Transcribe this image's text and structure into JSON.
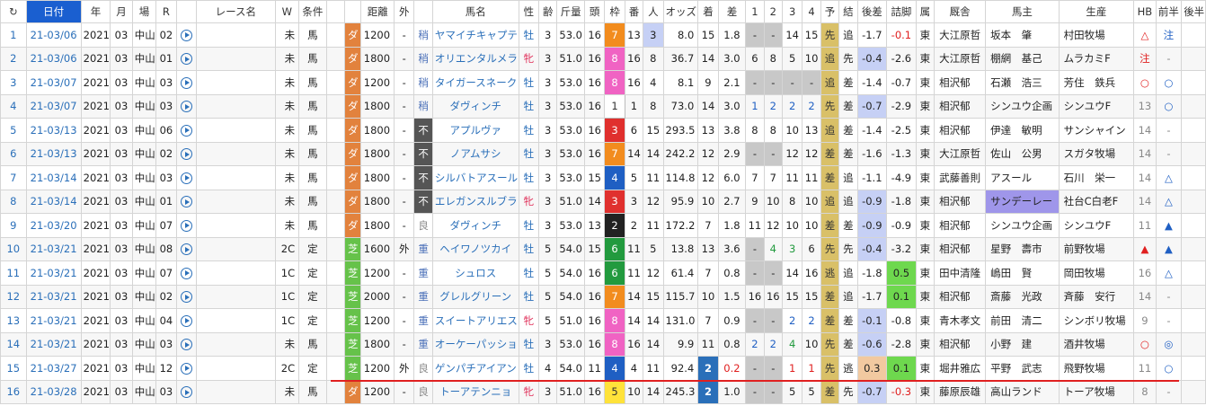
{
  "header": [
    "↻",
    "日付",
    "年",
    "月",
    "場",
    "R",
    "",
    "レース名",
    "W",
    "条件",
    "",
    "",
    "距離",
    "外",
    "",
    "馬名",
    "性",
    "齢",
    "斤量",
    "頭",
    "枠",
    "番",
    "人",
    "オッズ",
    "着",
    "差",
    "1",
    "2",
    "3",
    "4",
    "予",
    "結",
    "後差",
    "詰脚",
    "属",
    "厩舎",
    "馬主",
    "生産",
    "HB",
    "前半",
    "後半"
  ],
  "rows": [
    {
      "n": "1",
      "date": "21-03/06",
      "y": "2021",
      "m": "03",
      "jo": "中山",
      "r": "02",
      "w": "",
      "jk": "未",
      "ba": "馬",
      "surf": "ダ",
      "dist": "1200",
      "gai": "-",
      "mark": "稍",
      "horse": "ヤマイチキャプテン",
      "sex": "牡",
      "age": "3",
      "kin": "53.0",
      "tou": "16",
      "waku": "7",
      "ban": "13",
      "nin": "3",
      "odds": "8.0",
      "chaku": "15",
      "sa": "1.8",
      "p1": "-",
      "p2": "-",
      "p3": "14",
      "p4": "15",
      "yo": "先",
      "ke": "追",
      "kouh": "-1.7",
      "tsume": "-0.1",
      "zoku": "東",
      "kyu": "大江原哲",
      "owner": "坂本　肇",
      "breed": "村田牧場",
      "hb": "△",
      "zen": "注",
      "kou": ""
    },
    {
      "n": "2",
      "date": "21-03/06",
      "y": "2021",
      "m": "03",
      "jo": "中山",
      "r": "01",
      "w": "",
      "jk": "未",
      "ba": "馬",
      "surf": "ダ",
      "dist": "1800",
      "gai": "-",
      "mark": "稍",
      "horse": "オリエンタルメラク",
      "sex": "牝",
      "age": "3",
      "kin": "51.0",
      "tou": "16",
      "waku": "8",
      "ban": "16",
      "nin": "8",
      "odds": "36.7",
      "chaku": "14",
      "sa": "3.0",
      "p1": "6",
      "p2": "8",
      "p3": "5",
      "p4": "10",
      "yo": "追",
      "ke": "先",
      "kouh": "-0.4",
      "tsume": "-2.6",
      "zoku": "東",
      "kyu": "大江原哲",
      "owner": "棚網　基己",
      "breed": "ムラカミF",
      "hb": "注",
      "zen": "-",
      "kou": ""
    },
    {
      "n": "3",
      "date": "21-03/07",
      "y": "2021",
      "m": "03",
      "jo": "中山",
      "r": "03",
      "w": "",
      "jk": "未",
      "ba": "馬",
      "surf": "ダ",
      "dist": "1200",
      "gai": "-",
      "mark": "稍",
      "horse": "タイガースネーク",
      "sex": "牡",
      "age": "3",
      "kin": "53.0",
      "tou": "16",
      "waku": "8",
      "ban": "16",
      "nin": "4",
      "odds": "8.1",
      "chaku": "9",
      "sa": "2.1",
      "p1": "-",
      "p2": "-",
      "p3": "-",
      "p4": "-",
      "yo": "追",
      "ke": "差",
      "kouh": "-1.4",
      "tsume": "-0.7",
      "zoku": "東",
      "kyu": "相沢郁",
      "owner": "石瀬　浩三",
      "breed": "芳住　鉄兵",
      "hb": "○",
      "zen": "○",
      "kou": ""
    },
    {
      "n": "4",
      "date": "21-03/07",
      "y": "2021",
      "m": "03",
      "jo": "中山",
      "r": "03",
      "w": "",
      "jk": "未",
      "ba": "馬",
      "surf": "ダ",
      "dist": "1800",
      "gai": "-",
      "mark": "稍",
      "horse": "ダヴィンチ",
      "sex": "牡",
      "age": "3",
      "kin": "53.0",
      "tou": "16",
      "waku": "1",
      "ban": "1",
      "nin": "8",
      "odds": "73.0",
      "chaku": "14",
      "sa": "3.0",
      "p1": "1",
      "p2": "2",
      "p3": "2",
      "p4": "2",
      "yo": "先",
      "ke": "差",
      "kouh": "-0.7",
      "tsume": "-2.9",
      "zoku": "東",
      "kyu": "相沢郁",
      "owner": "シンユウ企画",
      "breed": "シンユウF",
      "hb": "13",
      "zen": "○",
      "kou": ""
    },
    {
      "n": "5",
      "date": "21-03/13",
      "y": "2021",
      "m": "03",
      "jo": "中山",
      "r": "06",
      "w": "",
      "jk": "未",
      "ba": "馬",
      "surf": "ダ",
      "dist": "1800",
      "gai": "-",
      "mark": "不",
      "horse": "アプルヴァ",
      "sex": "牡",
      "age": "3",
      "kin": "53.0",
      "tou": "16",
      "waku": "3",
      "ban": "6",
      "nin": "15",
      "odds": "293.5",
      "chaku": "13",
      "sa": "3.8",
      "p1": "8",
      "p2": "8",
      "p3": "10",
      "p4": "13",
      "yo": "追",
      "ke": "差",
      "kouh": "-1.4",
      "tsume": "-2.5",
      "zoku": "東",
      "kyu": "相沢郁",
      "owner": "伊達　敏明",
      "breed": "サンシャイン",
      "hb": "14",
      "zen": "-",
      "kou": ""
    },
    {
      "n": "6",
      "date": "21-03/13",
      "y": "2021",
      "m": "03",
      "jo": "中山",
      "r": "02",
      "w": "",
      "jk": "未",
      "ba": "馬",
      "surf": "ダ",
      "dist": "1800",
      "gai": "-",
      "mark": "不",
      "horse": "ノアムサシ",
      "sex": "牡",
      "age": "3",
      "kin": "53.0",
      "tou": "16",
      "waku": "7",
      "ban": "14",
      "nin": "14",
      "odds": "242.2",
      "chaku": "12",
      "sa": "2.9",
      "p1": "-",
      "p2": "-",
      "p3": "12",
      "p4": "12",
      "yo": "差",
      "ke": "差",
      "kouh": "-1.6",
      "tsume": "-1.3",
      "zoku": "東",
      "kyu": "大江原哲",
      "owner": "佐山　公男",
      "breed": "スガタ牧場",
      "hb": "14",
      "zen": "-",
      "kou": ""
    },
    {
      "n": "7",
      "date": "21-03/14",
      "y": "2021",
      "m": "03",
      "jo": "中山",
      "r": "03",
      "w": "",
      "jk": "未",
      "ba": "馬",
      "surf": "ダ",
      "dist": "1800",
      "gai": "-",
      "mark": "不",
      "horse": "シルバトアスール",
      "sex": "牡",
      "age": "3",
      "kin": "53.0",
      "tou": "15",
      "waku": "4",
      "ban": "5",
      "nin": "11",
      "odds": "114.8",
      "chaku": "12",
      "sa": "6.0",
      "p1": "7",
      "p2": "7",
      "p3": "11",
      "p4": "11",
      "yo": "差",
      "ke": "追",
      "kouh": "-1.1",
      "tsume": "-4.9",
      "zoku": "東",
      "kyu": "武藤善則",
      "owner": "アスール",
      "breed": "石川　栄一",
      "hb": "14",
      "zen": "△",
      "kou": ""
    },
    {
      "n": "8",
      "date": "21-03/14",
      "y": "2021",
      "m": "03",
      "jo": "中山",
      "r": "01",
      "w": "",
      "jk": "未",
      "ba": "馬",
      "surf": "ダ",
      "dist": "1800",
      "gai": "-",
      "mark": "不",
      "horse": "エレガンスルブラ",
      "sex": "牝",
      "age": "3",
      "kin": "51.0",
      "tou": "14",
      "waku": "3",
      "ban": "3",
      "nin": "12",
      "odds": "95.9",
      "chaku": "10",
      "sa": "2.7",
      "p1": "9",
      "p2": "10",
      "p3": "8",
      "p4": "10",
      "yo": "追",
      "ke": "追",
      "kouh": "-0.9",
      "tsume": "-1.8",
      "zoku": "東",
      "kyu": "相沢郁",
      "owner": "サンデーレー",
      "breed": "社台C白老F",
      "hb": "14",
      "zen": "△",
      "kou": ""
    },
    {
      "n": "9",
      "date": "21-03/20",
      "y": "2021",
      "m": "03",
      "jo": "中山",
      "r": "07",
      "w": "",
      "jk": "未",
      "ba": "馬",
      "surf": "ダ",
      "dist": "1800",
      "gai": "-",
      "mark": "良",
      "horse": "ダヴィンチ",
      "sex": "牡",
      "age": "3",
      "kin": "53.0",
      "tou": "13",
      "waku": "2",
      "ban": "2",
      "nin": "11",
      "odds": "172.2",
      "chaku": "7",
      "sa": "1.8",
      "p1": "11",
      "p2": "12",
      "p3": "10",
      "p4": "10",
      "yo": "差",
      "ke": "差",
      "kouh": "-0.9",
      "tsume": "-0.9",
      "zoku": "東",
      "kyu": "相沢郁",
      "owner": "シンユウ企画",
      "breed": "シンユウF",
      "hb": "11",
      "zen": "▲",
      "kou": ""
    },
    {
      "n": "10",
      "date": "21-03/21",
      "y": "2021",
      "m": "03",
      "jo": "中山",
      "r": "08",
      "w": "",
      "jk": "2C",
      "ba": "定",
      "surf": "芝",
      "dist": "1600",
      "gai": "外",
      "mark": "重",
      "horse": "ヘイワノツカイ",
      "sex": "牡",
      "age": "5",
      "kin": "54.0",
      "tou": "15",
      "waku": "6",
      "ban": "11",
      "nin": "5",
      "odds": "13.8",
      "chaku": "13",
      "sa": "3.6",
      "p1": "-",
      "p2": "4",
      "p3": "3",
      "p4": "6",
      "yo": "先",
      "ke": "先",
      "kouh": "-0.4",
      "tsume": "-3.2",
      "zoku": "東",
      "kyu": "相沢郁",
      "owner": "星野　壽市",
      "breed": "前野牧場",
      "hb": "▲",
      "zen": "▲",
      "kou": ""
    },
    {
      "n": "11",
      "date": "21-03/21",
      "y": "2021",
      "m": "03",
      "jo": "中山",
      "r": "07",
      "w": "",
      "jk": "1C",
      "ba": "定",
      "surf": "芝",
      "dist": "1200",
      "gai": "-",
      "mark": "重",
      "horse": "シュロス",
      "sex": "牡",
      "age": "5",
      "kin": "54.0",
      "tou": "16",
      "waku": "6",
      "ban": "11",
      "nin": "12",
      "odds": "61.4",
      "chaku": "7",
      "sa": "0.8",
      "p1": "-",
      "p2": "-",
      "p3": "14",
      "p4": "16",
      "yo": "逃",
      "ke": "追",
      "kouh": "-1.8",
      "tsume": "0.5",
      "zoku": "東",
      "kyu": "田中清隆",
      "owner": "嶋田　賢",
      "breed": "岡田牧場",
      "hb": "16",
      "zen": "△",
      "kou": ""
    },
    {
      "n": "12",
      "date": "21-03/21",
      "y": "2021",
      "m": "03",
      "jo": "中山",
      "r": "02",
      "w": "",
      "jk": "1C",
      "ba": "定",
      "surf": "芝",
      "dist": "2000",
      "gai": "-",
      "mark": "重",
      "horse": "グレルグリーン",
      "sex": "牡",
      "age": "5",
      "kin": "54.0",
      "tou": "16",
      "waku": "7",
      "ban": "14",
      "nin": "15",
      "odds": "115.7",
      "chaku": "10",
      "sa": "1.5",
      "p1": "16",
      "p2": "16",
      "p3": "15",
      "p4": "15",
      "yo": "差",
      "ke": "追",
      "kouh": "-1.7",
      "tsume": "0.1",
      "zoku": "東",
      "kyu": "相沢郁",
      "owner": "斎藤　光政",
      "breed": "斉藤　安行",
      "hb": "14",
      "zen": "-",
      "kou": ""
    },
    {
      "n": "13",
      "date": "21-03/21",
      "y": "2021",
      "m": "03",
      "jo": "中山",
      "r": "04",
      "w": "",
      "jk": "1C",
      "ba": "定",
      "surf": "芝",
      "dist": "1200",
      "gai": "-",
      "mark": "重",
      "horse": "スイートアリエス",
      "sex": "牝",
      "age": "5",
      "kin": "51.0",
      "tou": "16",
      "waku": "8",
      "ban": "14",
      "nin": "14",
      "odds": "131.0",
      "chaku": "7",
      "sa": "0.9",
      "p1": "-",
      "p2": "-",
      "p3": "2",
      "p4": "2",
      "yo": "差",
      "ke": "差",
      "kouh": "-0.1",
      "tsume": "-0.8",
      "zoku": "東",
      "kyu": "青木孝文",
      "owner": "前田　清二",
      "breed": "シンボリ牧場",
      "hb": "9",
      "zen": "-",
      "kou": ""
    },
    {
      "n": "14",
      "date": "21-03/21",
      "y": "2021",
      "m": "03",
      "jo": "中山",
      "r": "03",
      "w": "",
      "jk": "未",
      "ba": "馬",
      "surf": "芝",
      "dist": "1800",
      "gai": "-",
      "mark": "重",
      "horse": "オーケーパッション",
      "sex": "牡",
      "age": "3",
      "kin": "53.0",
      "tou": "16",
      "waku": "8",
      "ban": "16",
      "nin": "14",
      "odds": "9.9",
      "chaku": "11",
      "sa": "0.8",
      "p1": "2",
      "p2": "2",
      "p3": "4",
      "p4": "10",
      "yo": "先",
      "ke": "差",
      "kouh": "-0.6",
      "tsume": "-2.8",
      "zoku": "東",
      "kyu": "相沢郁",
      "owner": "小野　建",
      "breed": "酒井牧場",
      "hb": "○",
      "zen": "◎",
      "kou": ""
    },
    {
      "n": "15",
      "date": "21-03/27",
      "y": "2021",
      "m": "03",
      "jo": "中山",
      "r": "12",
      "w": "",
      "jk": "2C",
      "ba": "定",
      "surf": "芝",
      "dist": "1200",
      "gai": "外",
      "mark": "良",
      "horse": "ゲンパチアイアン",
      "sex": "牡",
      "age": "4",
      "kin": "54.0",
      "tou": "11",
      "waku": "4",
      "ban": "4",
      "nin": "11",
      "odds": "92.4",
      "chaku": "2",
      "sa": "0.2",
      "p1": "-",
      "p2": "-",
      "p3": "1",
      "p4": "1",
      "yo": "先",
      "ke": "逃",
      "kouh": "0.3",
      "tsume": "0.1",
      "zoku": "東",
      "kyu": "堀井雅広",
      "owner": "平野　武志",
      "breed": "飛野牧場",
      "hb": "11",
      "zen": "○",
      "kou": ""
    },
    {
      "n": "16",
      "date": "21-03/28",
      "y": "2021",
      "m": "03",
      "jo": "中山",
      "r": "03",
      "w": "",
      "jk": "未",
      "ba": "馬",
      "surf": "ダ",
      "dist": "1200",
      "gai": "-",
      "mark": "良",
      "horse": "トーアテンニョ",
      "sex": "牝",
      "age": "3",
      "kin": "51.0",
      "tou": "16",
      "waku": "5",
      "ban": "10",
      "nin": "14",
      "odds": "245.3",
      "chaku": "2",
      "sa": "1.0",
      "p1": "-",
      "p2": "-",
      "p3": "5",
      "p4": "5",
      "yo": "差",
      "ke": "先",
      "kouh": "-0.7",
      "tsume": "-0.3",
      "zoku": "東",
      "kyu": "藤原辰雄",
      "owner": "高山ランド",
      "breed": "トーア牧場",
      "hb": "8",
      "zen": "-",
      "kou": ""
    }
  ]
}
